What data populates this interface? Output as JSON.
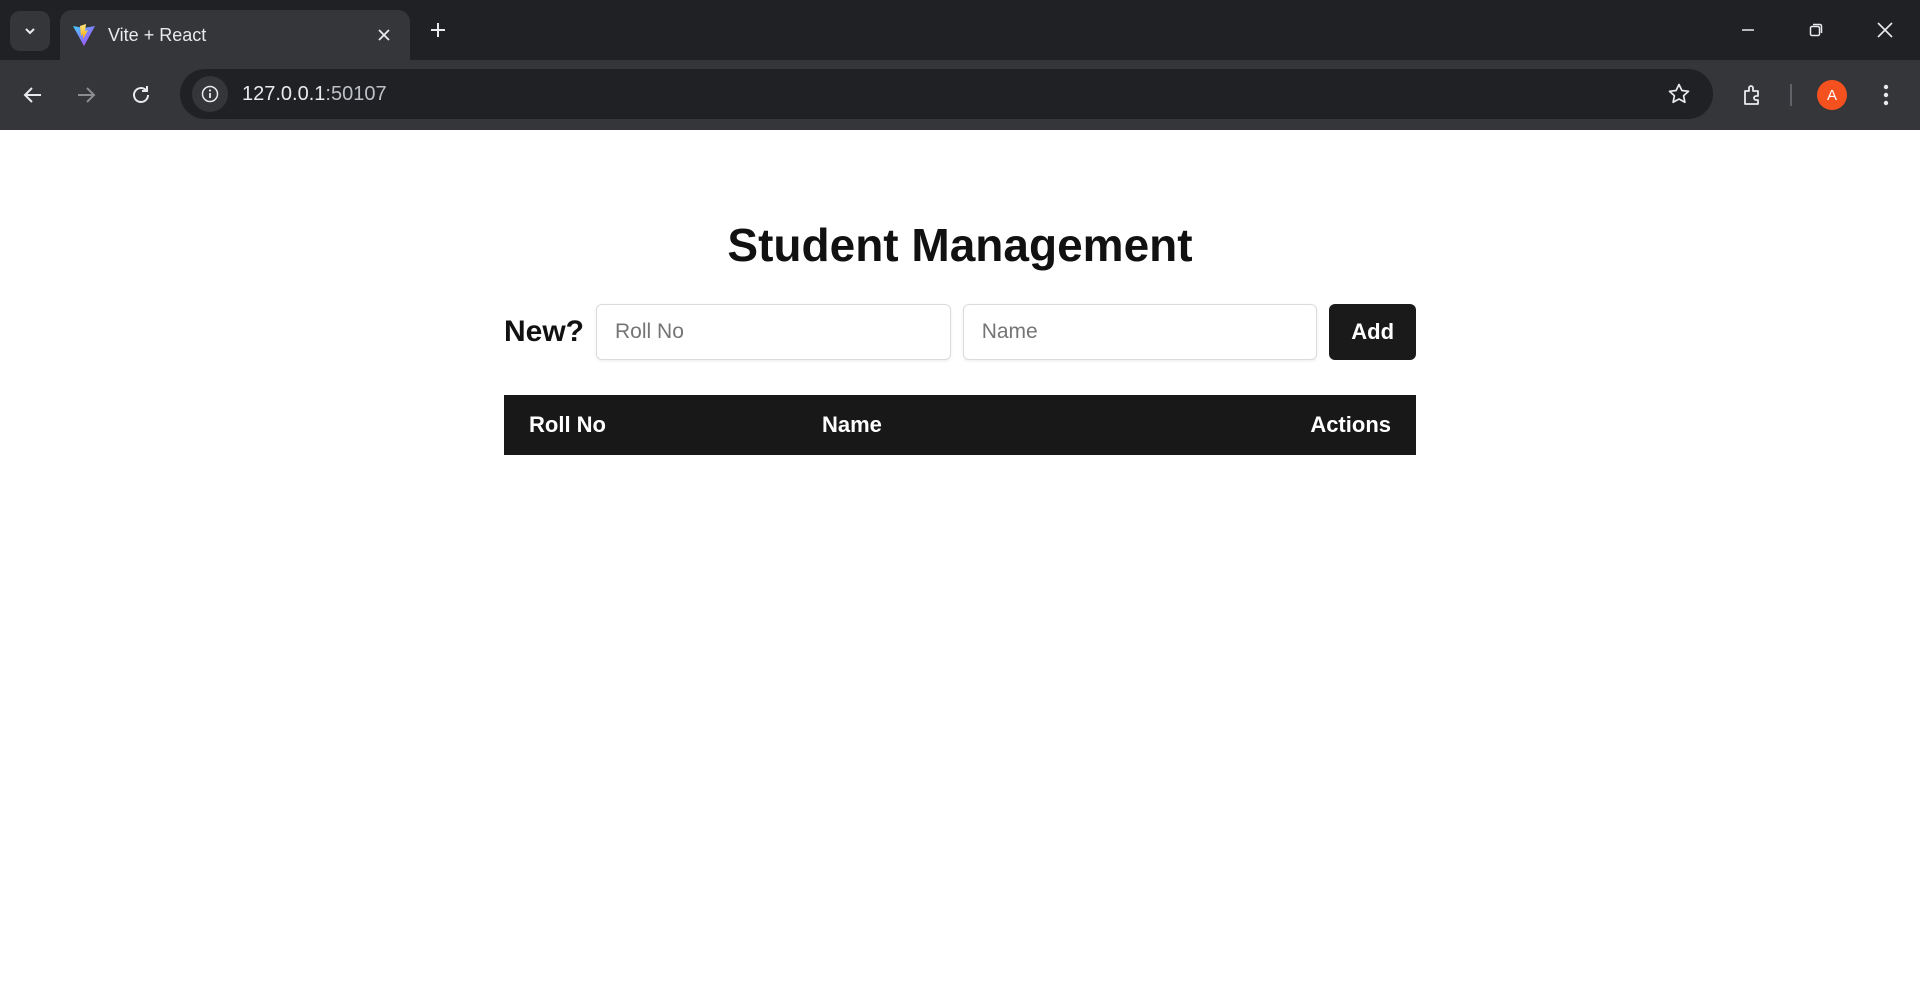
{
  "browser": {
    "tab": {
      "title": "Vite + React"
    },
    "address": {
      "host": "127.0.0.1",
      "port": ":50107"
    },
    "profile_initial": "A",
    "colors": {
      "frame": "#202124",
      "toolbar": "#35363a",
      "avatar": "#f4511e"
    },
    "icons": [
      "tab-search-icon",
      "vite-favicon-icon",
      "close-icon",
      "plus-icon",
      "minimize-icon",
      "restore-icon",
      "window-close-icon",
      "back-icon",
      "forward-icon",
      "reload-icon",
      "site-info-icon",
      "star-icon",
      "extensions-icon",
      "more-icon"
    ]
  },
  "page": {
    "title": "Student Management",
    "form": {
      "label": "New?",
      "roll_placeholder": "Roll No",
      "name_placeholder": "Name",
      "add_label": "Add"
    },
    "table": {
      "columns": [
        "Roll No",
        "Name",
        "Actions"
      ],
      "rows": []
    },
    "colors": {
      "header_bg": "#181818",
      "button_bg": "#1a1a1a"
    }
  }
}
